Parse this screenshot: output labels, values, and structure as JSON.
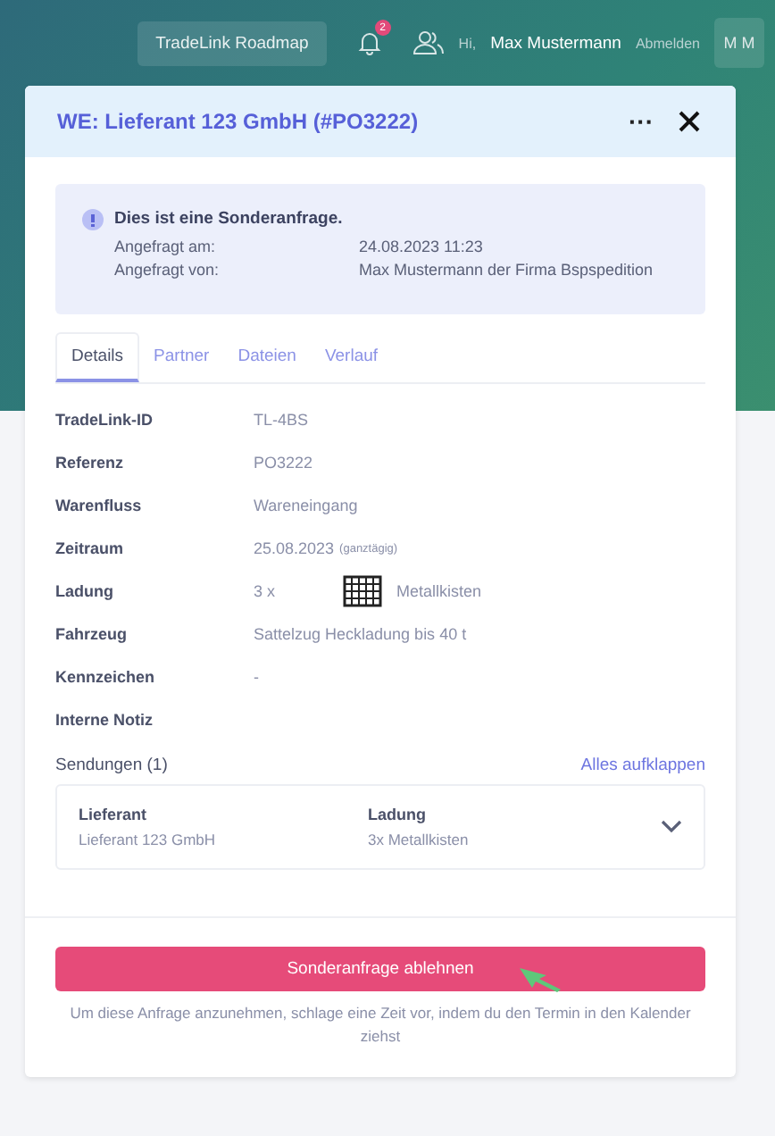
{
  "topbar": {
    "roadmap_button": "TradeLink Roadmap",
    "notification_count": "2",
    "greeting": "Hi,",
    "user_name": "Max Mustermann",
    "logout": "Abmelden",
    "avatar_initials": "M M"
  },
  "modal": {
    "title": "WE: Lieferant 123 GmbH (#PO3222)",
    "menu_label": "···",
    "notice": {
      "heading": "Dies ist eine Sonderanfrage.",
      "rows": [
        {
          "label": "Angefragt am:",
          "value": "24.08.2023 11:23"
        },
        {
          "label": "Angefragt von:",
          "value": "Max Mustermann der Firma Bspspedition"
        }
      ]
    },
    "tabs": [
      {
        "label": "Details",
        "selected": true
      },
      {
        "label": "Partner",
        "selected": false
      },
      {
        "label": "Dateien",
        "selected": false
      },
      {
        "label": "Verlauf",
        "selected": false
      }
    ],
    "details": [
      {
        "label": "TradeLink-ID",
        "value": "TL-4BS"
      },
      {
        "label": "Referenz",
        "value": "PO3222"
      },
      {
        "label": "Warenfluss",
        "value": "Wareneingang"
      },
      {
        "label": "Zeitraum",
        "value": "25.08.2023",
        "note": "(ganztägig)"
      },
      {
        "label": "Ladung",
        "value": "3 x",
        "kind": "cargo",
        "cargo_name": "Metallkisten"
      },
      {
        "label": "Fahrzeug",
        "value": "Sattelzug Heckladung bis 40 t"
      },
      {
        "label": "Kennzeichen",
        "value": "-"
      },
      {
        "label": "Interne Notiz"
      }
    ],
    "shipments": {
      "title": "Sendungen (1)",
      "expand_all": "Alles aufklappen",
      "items": [
        {
          "supplier_label": "Lieferant",
          "supplier": "Lieferant 123 GmbH",
          "cargo_label": "Ladung",
          "cargo": "3x Metallkisten",
          "expanded": false
        }
      ]
    },
    "reject_button": "Sonderanfrage ablehnen",
    "hint": "Um diese Anfrage anzunehmen, schlage eine Zeit vor, indem du den Termin in den Kalender ziehst"
  }
}
